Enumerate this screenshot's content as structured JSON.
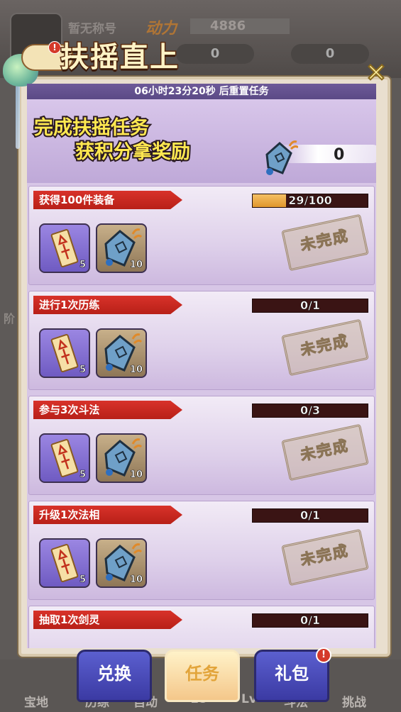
{
  "background": {
    "player_name": "暂无称号",
    "power_label": "动力",
    "power_value": "4886",
    "resource_values": [
      "0",
      "0"
    ],
    "nav": [
      "宝地",
      "历练",
      "自动",
      "18",
      "Lv",
      "斗法",
      "挑战"
    ],
    "side_label": "阶"
  },
  "title": "扶摇直上",
  "title_badge": "!",
  "close_label": "✕",
  "timer_text": "06小时23分20秒 后重置任务",
  "hero": {
    "line1": "完成扶摇任务",
    "line2": "获积分拿奖励",
    "points": "0"
  },
  "tasks": [
    {
      "title": "获得100件装备",
      "progress_text": "29/100",
      "progress": 0.29,
      "rewards": [
        {
          "icon": "talisman-icon",
          "qty": "5"
        },
        {
          "icon": "kite-icon",
          "qty": "10"
        }
      ],
      "status": "未完成"
    },
    {
      "title": "进行1次历练",
      "progress_text": "0/1",
      "progress": 0,
      "rewards": [
        {
          "icon": "talisman-icon",
          "qty": "5"
        },
        {
          "icon": "kite-icon",
          "qty": "10"
        }
      ],
      "status": "未完成"
    },
    {
      "title": "参与3次斗法",
      "progress_text": "0/3",
      "progress": 0,
      "rewards": [
        {
          "icon": "talisman-icon",
          "qty": "5"
        },
        {
          "icon": "kite-icon",
          "qty": "10"
        }
      ],
      "status": "未完成"
    },
    {
      "title": "升级1次法相",
      "progress_text": "0/1",
      "progress": 0,
      "rewards": [
        {
          "icon": "talisman-icon",
          "qty": "5"
        },
        {
          "icon": "kite-icon",
          "qty": "10"
        }
      ],
      "status": "未完成"
    },
    {
      "title": "抽取1次剑灵",
      "progress_text": "0/1",
      "progress": 0,
      "rewards": [],
      "status": ""
    }
  ],
  "tabs": [
    {
      "label": "兑换",
      "active": false,
      "badge": ""
    },
    {
      "label": "任务",
      "active": true,
      "badge": ""
    },
    {
      "label": "礼包",
      "active": false,
      "badge": "!"
    }
  ],
  "colors": {
    "ribbon": "#d8322a",
    "progress_fill": "#e0962c",
    "hero_text": "#ffe850",
    "tab_blue": "#3b3aa3"
  }
}
